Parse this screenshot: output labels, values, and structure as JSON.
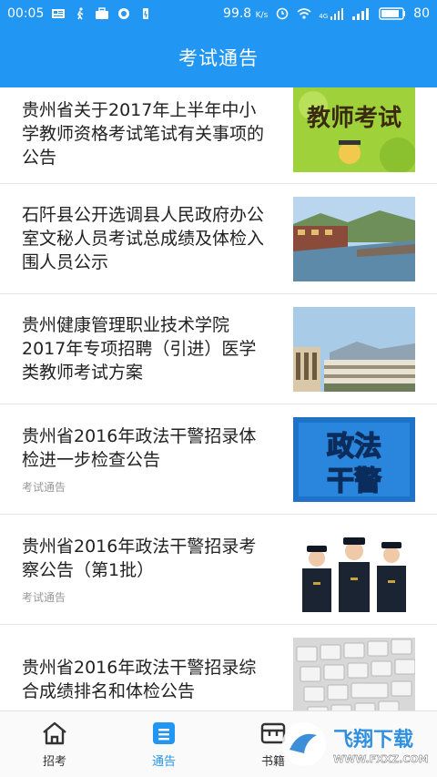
{
  "status": {
    "time": "00:05",
    "speed": "99.8",
    "speed_unit": "K/s",
    "network": "4G",
    "battery": "80"
  },
  "header": {
    "title": "考试通告"
  },
  "items": [
    {
      "title": "贵州省关于2017年上半年中小学教师资格考试笔试有关事项的公告",
      "tag": "",
      "thumb_text": "教师考试"
    },
    {
      "title": "石阡县公开选调县人民政府办公室文秘人员考试总成绩及体检入围人员公示",
      "tag": ""
    },
    {
      "title": "贵州健康管理职业技术学院2017年专项招聘（引进）医学类教师考试方案",
      "tag": ""
    },
    {
      "title": "贵州省2016年政法干警招录体检进一步检查公告",
      "tag": "考试通告",
      "thumb_text_1": "政法",
      "thumb_text_2": "干警"
    },
    {
      "title": "贵州省2016年政法干警招录考察公告（第1批）",
      "tag": "考试通告"
    },
    {
      "title": "贵州省2016年政法干警招录综合成绩排名和体检公告",
      "tag": ""
    }
  ],
  "tabs": [
    {
      "label": "招考",
      "icon": "home-icon"
    },
    {
      "label": "通告",
      "icon": "notice-icon"
    },
    {
      "label": "书籍",
      "icon": "book-icon"
    },
    {
      "label": "",
      "icon": ""
    }
  ],
  "watermark": {
    "text": "飞翔下载",
    "url": "WWW.FXXZ.COM"
  },
  "colors": {
    "primary": "#2196f3",
    "divider": "#e6e6e6"
  }
}
